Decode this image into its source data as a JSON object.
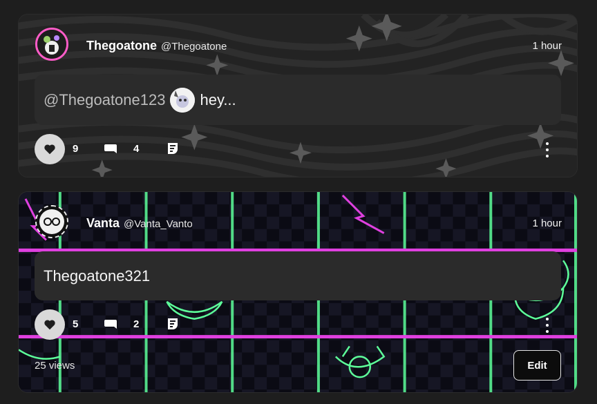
{
  "posts": [
    {
      "display_name": "Thegoatone",
      "handle": "@Thegoatone",
      "time": "1 hour",
      "mention": "@Thegoatone123",
      "text": "hey...",
      "likes": "9",
      "comments": "4",
      "accent": "#ff5cc8"
    },
    {
      "display_name": "Vanta",
      "handle": "@Vanta_Vanto",
      "time": "1 hour",
      "text": "Thegoatone321",
      "likes": "5",
      "comments": "2",
      "views": "25 views",
      "edit_label": "Edit",
      "neon_colors": {
        "pink": "#e040e0",
        "green": "#5dff9a"
      }
    }
  ],
  "icons": {
    "like": "heart-icon",
    "comment": "comment-icon",
    "share": "share-icon",
    "more": "more-vertical-icon"
  }
}
